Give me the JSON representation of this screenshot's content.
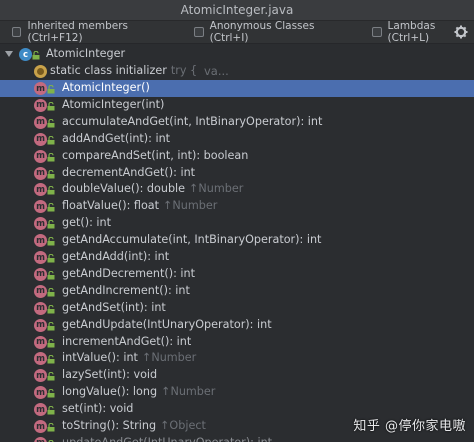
{
  "window": {
    "title": "AtomicInteger.java"
  },
  "toolbar": {
    "inherited_label": "Inherited members (Ctrl+F12)",
    "anonymous_label": "Anonymous Classes (Ctrl+I)",
    "lambdas_label": "Lambdas (Ctrl+L)"
  },
  "tree": {
    "root": "AtomicInteger",
    "static_init": {
      "label": "static class initializer",
      "hint1": "try {",
      "hint2": "va..."
    },
    "methods": [
      {
        "label": "AtomicInteger()",
        "hint": "",
        "selected": true
      },
      {
        "label": "AtomicInteger(int)",
        "hint": ""
      },
      {
        "label": "accumulateAndGet(int, IntBinaryOperator): int",
        "hint": ""
      },
      {
        "label": "addAndGet(int): int",
        "hint": ""
      },
      {
        "label": "compareAndSet(int, int): boolean",
        "hint": ""
      },
      {
        "label": "decrementAndGet(): int",
        "hint": ""
      },
      {
        "label": "doubleValue(): double",
        "hint": "↑Number"
      },
      {
        "label": "floatValue(): float",
        "hint": "↑Number"
      },
      {
        "label": "get(): int",
        "hint": ""
      },
      {
        "label": "getAndAccumulate(int, IntBinaryOperator): int",
        "hint": ""
      },
      {
        "label": "getAndAdd(int): int",
        "hint": ""
      },
      {
        "label": "getAndDecrement(): int",
        "hint": ""
      },
      {
        "label": "getAndIncrement(): int",
        "hint": ""
      },
      {
        "label": "getAndSet(int): int",
        "hint": ""
      },
      {
        "label": "getAndUpdate(IntUnaryOperator): int",
        "hint": ""
      },
      {
        "label": "incrementAndGet(): int",
        "hint": ""
      },
      {
        "label": "intValue(): int",
        "hint": "↑Number"
      },
      {
        "label": "lazySet(int): void",
        "hint": ""
      },
      {
        "label": "longValue(): long",
        "hint": "↑Number"
      },
      {
        "label": "set(int): void",
        "hint": ""
      },
      {
        "label": "toString(): String",
        "hint": "↑Object"
      },
      {
        "label": "updateAndGet(IntUnaryOperator): int",
        "hint": ""
      }
    ]
  },
  "watermark": "知乎 @停你家电嗷",
  "colors": {
    "selection": "#4b6eaf",
    "method_icon": "#c36a7f",
    "class_icon": "#3e8bc6",
    "lock": "#7fb24a"
  }
}
